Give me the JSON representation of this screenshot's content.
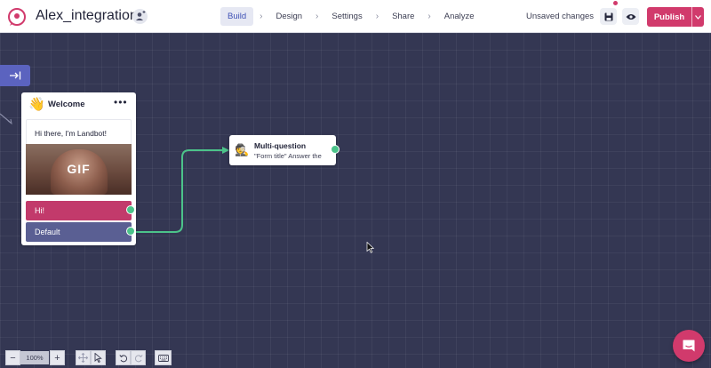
{
  "header": {
    "title": "Alex_integration",
    "nav": [
      {
        "label": "Build",
        "active": true
      },
      {
        "label": "Design"
      },
      {
        "label": "Settings"
      },
      {
        "label": "Share"
      },
      {
        "label": "Analyze"
      }
    ],
    "separator": "›",
    "status": "Unsaved changes",
    "publish_label": "Publish"
  },
  "canvas": {
    "welcome": {
      "emoji": "👋",
      "title": "Welcome",
      "menu": "•••",
      "message": "Hi there, I'm Landbot!",
      "gif_label": "GIF",
      "buttons": [
        "Hi!",
        "Default"
      ]
    },
    "multi_question": {
      "emoji": "🕵",
      "title": "Multi-question",
      "subtitle": "\"Form title\" Answer the"
    }
  },
  "toolbar": {
    "zoom_out": "−",
    "zoom_level": "100%",
    "zoom_in": "+"
  },
  "colors": {
    "accent": "#d13a6c",
    "canvas_bg": "#343753",
    "connector": "#4cc38a",
    "nav_active": "#3f51b5",
    "default_button": "#5a5f93"
  },
  "icons": [
    "logo-icon",
    "add-user-icon",
    "save-icon",
    "preview-icon",
    "chevron-down-icon",
    "collapse-panel-icon",
    "move-tool-icon",
    "pointer-tool-icon",
    "undo-icon",
    "redo-icon",
    "keyboard-icon",
    "chat-icon"
  ]
}
